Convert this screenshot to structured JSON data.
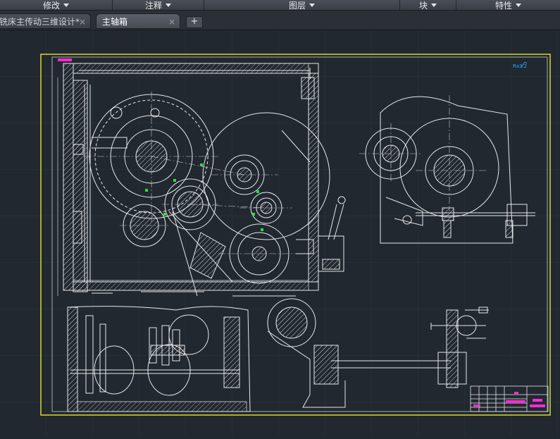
{
  "ribbon": {
    "panels": [
      {
        "label": "修改"
      },
      {
        "label": "注释"
      },
      {
        "label": "图层"
      },
      {
        "label": "块"
      },
      {
        "label": "特性"
      }
    ]
  },
  "tabs": [
    {
      "label": "铣床主传动三维设计*",
      "close": "×"
    },
    {
      "label": "主轴箱",
      "close": "×"
    }
  ],
  "new_tab_label": "+",
  "drawing": {
    "roughness_mark": "Ra3.2"
  },
  "colors": {
    "background": "#212830",
    "grid": "#2b333d",
    "lines": "#e8e8e8",
    "frame": "#e5e52a",
    "accent": "#ff2bd6",
    "highlight": "#26e040"
  }
}
